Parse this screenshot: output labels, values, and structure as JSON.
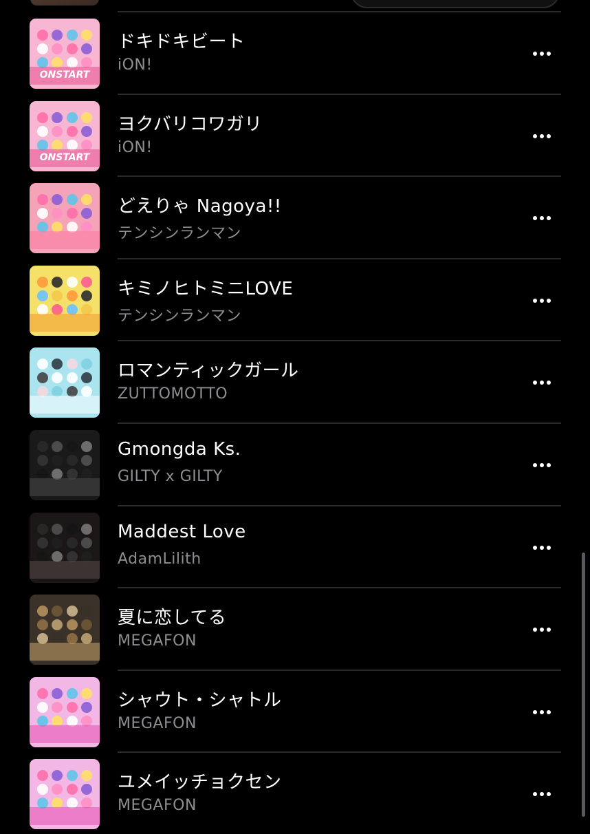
{
  "songs": [
    {
      "title": "ドキドキビート",
      "artist": "iON!",
      "art_caption": "ONSTART",
      "art_bg": "#f7b6d2",
      "art_accent": "#e8508f",
      "art_style": "pink"
    },
    {
      "title": "ヨクバリコワガリ",
      "artist": "iON!",
      "art_caption": "ONSTART",
      "art_bg": "#f7b6d2",
      "art_accent": "#e8508f",
      "art_style": "pink"
    },
    {
      "title": "どえりゃ Nagoya!!",
      "artist": "テンシンランマン",
      "art_caption": "",
      "art_bg": "#f4a3b8",
      "art_accent": "#ff7aa0",
      "art_style": "pink"
    },
    {
      "title": "キミノヒトミニLOVE",
      "artist": "テンシンランマン",
      "art_caption": "",
      "art_bg": "#f5e06a",
      "art_accent": "#f29a2e",
      "art_style": "yellow"
    },
    {
      "title": "ロマンティックガール",
      "artist": "ZUTTOMOTTO",
      "art_caption": "",
      "art_bg": "#a9e4ef",
      "art_accent": "#ffffff",
      "art_style": "cyan"
    },
    {
      "title": "Gmongda Ks.",
      "artist": "GILTY x GILTY",
      "art_caption": "",
      "art_bg": "#1a1a1a",
      "art_accent": "#4a4a4a",
      "art_style": "dark"
    },
    {
      "title": "Maddest Love",
      "artist": "AdamLilith",
      "art_caption": "",
      "art_bg": "#1b1717",
      "art_accent": "#5a4a48",
      "art_style": "dark"
    },
    {
      "title": "夏に恋してる",
      "artist": "MEGAFON",
      "art_caption": "",
      "art_bg": "#3a3128",
      "art_accent": "#c9a46a",
      "art_style": "gold"
    },
    {
      "title": "シャウト・シャトル",
      "artist": "MEGAFON",
      "art_caption": "",
      "art_bg": "#f3b7e6",
      "art_accent": "#e54fb0",
      "art_style": "pink"
    },
    {
      "title": "ユメイッチョクセン",
      "artist": "MEGAFON",
      "art_caption": "",
      "art_bg": "#f3b7e6",
      "art_accent": "#e54fb0",
      "art_style": "pink"
    }
  ],
  "icons": {
    "more": "more-options-icon"
  },
  "colors": {
    "background": "#000000",
    "title_text": "#ffffff",
    "artist_text": "#8e8e93",
    "separator": "#2a2a2c"
  }
}
